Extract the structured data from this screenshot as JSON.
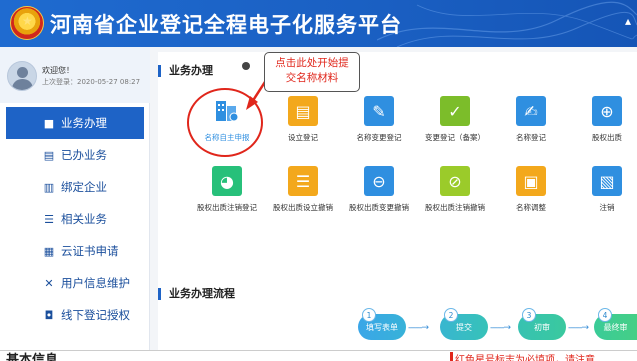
{
  "header": {
    "title": "河南省企业登记全程电子化服务平台"
  },
  "sidebar": {
    "profile": {
      "welcome": "欢迎您！",
      "last_login": "上次登录：2020-05-27 08:27"
    },
    "items": [
      {
        "label": "业务办理",
        "icon": "briefcase-icon",
        "active": true
      },
      {
        "label": "已办业务",
        "icon": "document-icon",
        "active": false
      },
      {
        "label": "绑定企业",
        "icon": "building-icon",
        "active": false
      },
      {
        "label": "相关业务",
        "icon": "list-icon",
        "active": false
      },
      {
        "label": "云证书申请",
        "icon": "certificate-icon",
        "active": false
      },
      {
        "label": "用户信息维护",
        "icon": "tools-icon",
        "active": false
      },
      {
        "label": "线下登记授权",
        "icon": "lock-icon",
        "active": false
      }
    ]
  },
  "business": {
    "section_title": "业务办理",
    "callout": [
      "点击此处开始提",
      "交名称材料"
    ],
    "tiles_row1": [
      {
        "label": "名称自主申报",
        "color": "#2f8fe0",
        "icon": "name-apply-icon"
      },
      {
        "label": "设立登记",
        "color": "#f3a81c",
        "icon": "clipboard-icon"
      },
      {
        "label": "名称变更登记",
        "color": "#2f8fe0",
        "icon": "edit-doc-icon"
      },
      {
        "label": "变更登记（备案）",
        "color": "#7cbd2a",
        "icon": "clipboard-check-icon"
      },
      {
        "label": "名称登记",
        "color": "#2f8fe0",
        "icon": "pen-doc-icon"
      },
      {
        "label": "股权出质",
        "color": "#2f8fe0",
        "icon": "equity-icon"
      }
    ],
    "tiles_row2": [
      {
        "label": "股权出质注销登记",
        "color": "#27c07a",
        "icon": "pie-chart-icon"
      },
      {
        "label": "股权出质设立撤销",
        "color": "#f3a81c",
        "icon": "list-cancel-icon"
      },
      {
        "label": "股权出质变更撤销",
        "color": "#2f8fe0",
        "icon": "minus-circle-icon"
      },
      {
        "label": "股权出质注销撤销",
        "color": "#9bcb2a",
        "icon": "check-circle-icon"
      },
      {
        "label": "名称调整",
        "color": "#f3a81c",
        "icon": "adjust-doc-icon"
      },
      {
        "label": "注销",
        "color": "#2f8fe0",
        "icon": "cancel-doc-icon"
      }
    ]
  },
  "flow": {
    "section_title": "业务办理流程",
    "steps": [
      {
        "num": "1",
        "label": "填写表单"
      },
      {
        "num": "2",
        "label": "提交"
      },
      {
        "num": "3",
        "label": "初审"
      },
      {
        "num": "4",
        "label": "最终审"
      }
    ],
    "arrow": "------→"
  },
  "bottom": {
    "left_heading": "基本信息",
    "right_note": "红色星号标志为必填项，请注意"
  }
}
